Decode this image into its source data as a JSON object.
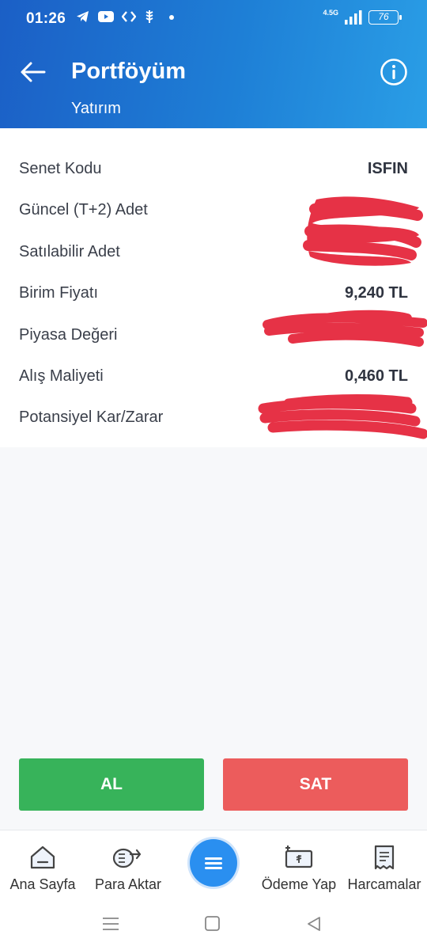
{
  "status_bar": {
    "time": "01:26",
    "network": "4.5G",
    "battery": "76"
  },
  "header": {
    "title": "Portföyüm",
    "subtitle": "Yatırım"
  },
  "details": [
    {
      "label": "Senet Kodu",
      "value": "ISFIN"
    },
    {
      "label": "Güncel (T+2) Adet",
      "value": ""
    },
    {
      "label": "Satılabilir Adet",
      "value": ""
    },
    {
      "label": "Birim Fiyatı",
      "value": "9,240 TL"
    },
    {
      "label": "Piyasa Değeri",
      "value": ""
    },
    {
      "label": "Alış Maliyeti",
      "value": "0,460 TL"
    },
    {
      "label": "Potansiyel Kar/Zarar",
      "value": ""
    }
  ],
  "actions": {
    "buy_label": "AL",
    "sell_label": "SAT"
  },
  "bottom_nav": [
    {
      "label": "Ana Sayfa",
      "icon": "home-icon"
    },
    {
      "label": "Para Aktar",
      "icon": "transfer-icon"
    },
    {
      "label": "",
      "icon": "menu-icon"
    },
    {
      "label": "Ödeme Yap",
      "icon": "payment-icon"
    },
    {
      "label": "Harcamalar",
      "icon": "receipt-icon"
    }
  ],
  "colors": {
    "header_start": "#1b5fc6",
    "header_end": "#2a9ee6",
    "buy": "#37b35a",
    "sell": "#ec5c5c",
    "redaction": "#e63246",
    "menu_button": "#2a8ff0"
  }
}
